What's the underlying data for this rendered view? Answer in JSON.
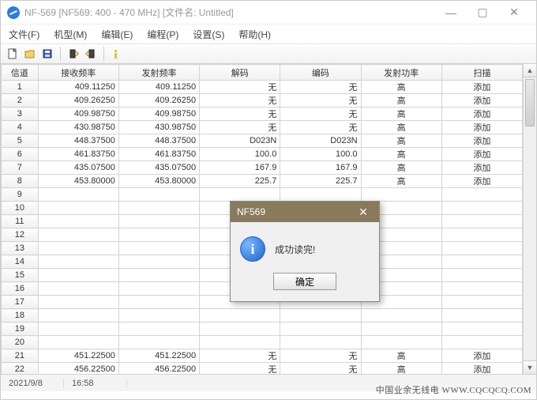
{
  "window": {
    "title": "NF-569 [NF569: 400 - 470 MHz] [文件名: Untitled]"
  },
  "menu": {
    "file": "文件(F)",
    "model": "机型(M)",
    "edit": "编辑(E)",
    "program": "编程(P)",
    "settings": "设置(S)",
    "help": "帮助(H)"
  },
  "columns": {
    "channel": "信道",
    "rxfreq": "接收频率",
    "txfreq": "发射频率",
    "decode": "解码",
    "encode": "编码",
    "txpower": "发射功率",
    "scan": "扫描"
  },
  "rows": [
    {
      "n": "1",
      "rx": "409.11250",
      "tx": "409.11250",
      "dec": "无",
      "enc": "无",
      "pw": "高",
      "sc": "添加"
    },
    {
      "n": "2",
      "rx": "409.26250",
      "tx": "409.26250",
      "dec": "无",
      "enc": "无",
      "pw": "高",
      "sc": "添加"
    },
    {
      "n": "3",
      "rx": "409.98750",
      "tx": "409.98750",
      "dec": "无",
      "enc": "无",
      "pw": "高",
      "sc": "添加"
    },
    {
      "n": "4",
      "rx": "430.98750",
      "tx": "430.98750",
      "dec": "无",
      "enc": "无",
      "pw": "高",
      "sc": "添加"
    },
    {
      "n": "5",
      "rx": "448.37500",
      "tx": "448.37500",
      "dec": "D023N",
      "enc": "D023N",
      "pw": "高",
      "sc": "添加"
    },
    {
      "n": "6",
      "rx": "461.83750",
      "tx": "461.83750",
      "dec": "100.0",
      "enc": "100.0",
      "pw": "高",
      "sc": "添加"
    },
    {
      "n": "7",
      "rx": "435.07500",
      "tx": "435.07500",
      "dec": "167.9",
      "enc": "167.9",
      "pw": "高",
      "sc": "添加"
    },
    {
      "n": "8",
      "rx": "453.80000",
      "tx": "453.80000",
      "dec": "225.7",
      "enc": "225.7",
      "pw": "高",
      "sc": "添加"
    },
    {
      "n": "9",
      "rx": "",
      "tx": "",
      "dec": "",
      "enc": "",
      "pw": "",
      "sc": ""
    },
    {
      "n": "10",
      "rx": "",
      "tx": "",
      "dec": "",
      "enc": "",
      "pw": "",
      "sc": ""
    },
    {
      "n": "11",
      "rx": "",
      "tx": "",
      "dec": "",
      "enc": "",
      "pw": "",
      "sc": ""
    },
    {
      "n": "12",
      "rx": "",
      "tx": "",
      "dec": "",
      "enc": "",
      "pw": "",
      "sc": ""
    },
    {
      "n": "13",
      "rx": "",
      "tx": "",
      "dec": "",
      "enc": "",
      "pw": "",
      "sc": ""
    },
    {
      "n": "14",
      "rx": "",
      "tx": "",
      "dec": "",
      "enc": "",
      "pw": "",
      "sc": ""
    },
    {
      "n": "15",
      "rx": "",
      "tx": "",
      "dec": "",
      "enc": "",
      "pw": "",
      "sc": ""
    },
    {
      "n": "16",
      "rx": "",
      "tx": "",
      "dec": "",
      "enc": "",
      "pw": "",
      "sc": ""
    },
    {
      "n": "17",
      "rx": "",
      "tx": "",
      "dec": "",
      "enc": "",
      "pw": "",
      "sc": ""
    },
    {
      "n": "18",
      "rx": "",
      "tx": "",
      "dec": "",
      "enc": "",
      "pw": "",
      "sc": ""
    },
    {
      "n": "19",
      "rx": "",
      "tx": "",
      "dec": "",
      "enc": "",
      "pw": "",
      "sc": ""
    },
    {
      "n": "20",
      "rx": "",
      "tx": "",
      "dec": "",
      "enc": "",
      "pw": "",
      "sc": ""
    },
    {
      "n": "21",
      "rx": "451.22500",
      "tx": "451.22500",
      "dec": "无",
      "enc": "无",
      "pw": "高",
      "sc": "添加"
    },
    {
      "n": "22",
      "rx": "456.22500",
      "tx": "456.22500",
      "dec": "无",
      "enc": "无",
      "pw": "高",
      "sc": "添加"
    }
  ],
  "status": {
    "date": "2021/9/8",
    "time": "16:58"
  },
  "watermark": "中国业余无线电 WWW.CQCQCQ.COM",
  "dialog": {
    "title": "NF569",
    "message": "成功读完!",
    "ok": "确定"
  }
}
